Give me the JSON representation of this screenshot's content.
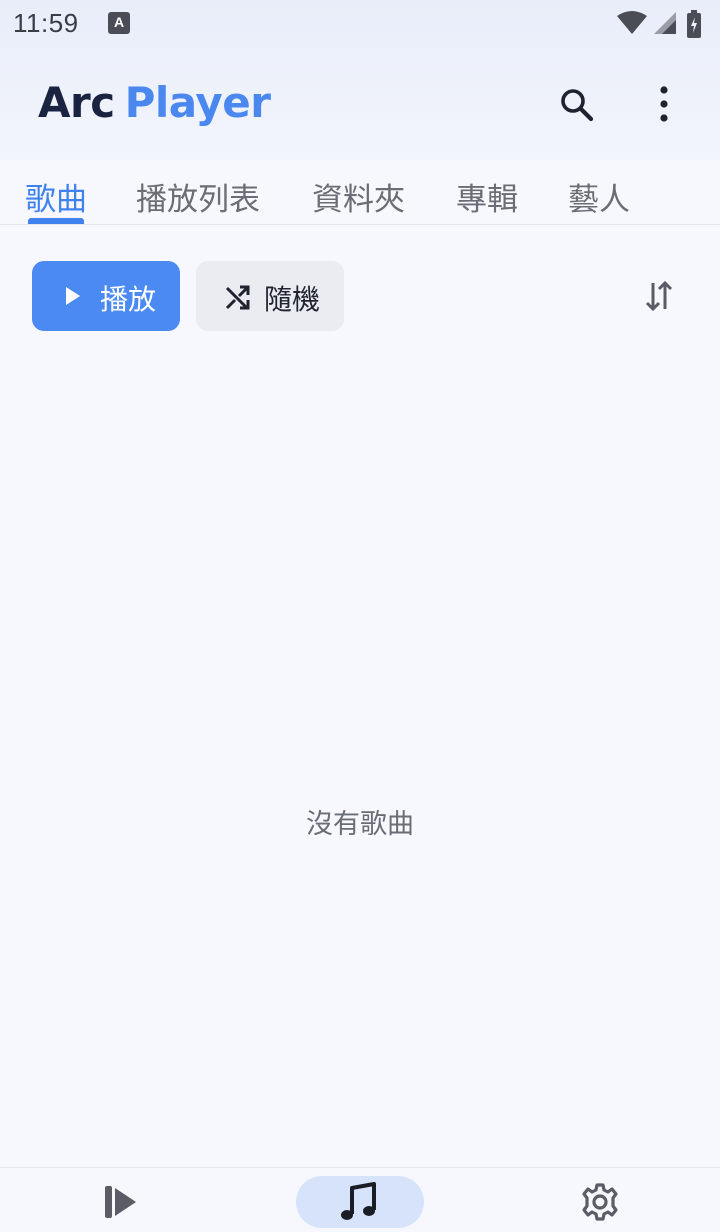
{
  "status_bar": {
    "time": "11:59",
    "notification_icon": "A"
  },
  "app_bar": {
    "title_part1": "Arc",
    "title_part2": "Player",
    "icons": [
      "search-icon",
      "more-vert-icon"
    ]
  },
  "tabs": [
    {
      "label": "歌曲",
      "active": true
    },
    {
      "label": "播放列表",
      "active": false
    },
    {
      "label": "資料夾",
      "active": false
    },
    {
      "label": "專輯",
      "active": false
    },
    {
      "label": "藝人",
      "active": false
    }
  ],
  "actions": {
    "play_label": "播放",
    "shuffle_label": "隨機"
  },
  "empty_state": "沒有歌曲",
  "bottom_nav": {
    "items": [
      "now-playing-icon",
      "music-note-icon",
      "settings-icon"
    ],
    "selected": "music-note-icon"
  },
  "colors": {
    "accent": "#4a8af2",
    "title_dark": "#1a2340",
    "background": "#f7f8fe"
  }
}
